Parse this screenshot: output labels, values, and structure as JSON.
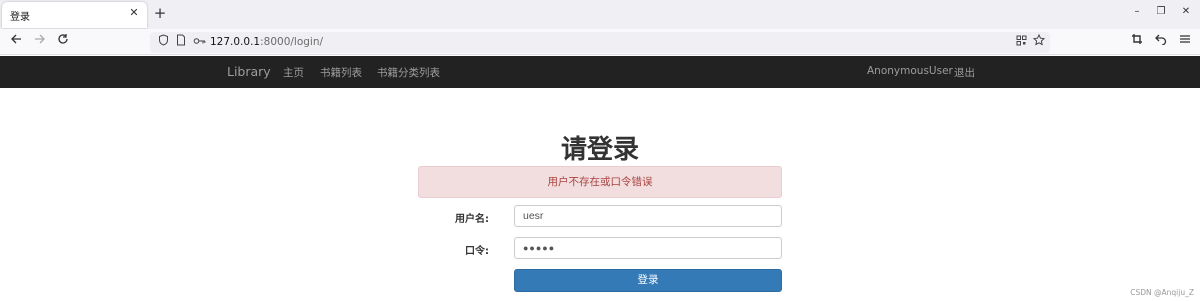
{
  "browser": {
    "tab_title": "登录",
    "tab_close": "✕",
    "new_tab": "+",
    "url_host": "127.0.0.1",
    "url_rest": ":8000/login/",
    "window_controls": {
      "minimize": "–",
      "restore": "❐",
      "close": "✕"
    },
    "icons": [
      "back-arrow",
      "forward-arrow",
      "reload",
      "shield",
      "page",
      "key",
      "qr-code",
      "star",
      "crop",
      "undo",
      "menu"
    ]
  },
  "navbar": {
    "brand": "Library",
    "links": [
      "主页",
      "书籍列表",
      "书籍分类列表"
    ],
    "user": "AnonymousUser",
    "logout": "退出"
  },
  "login": {
    "title": "请登录",
    "alert": "用户不存在或口令错误",
    "username_label": "用户名:",
    "username_value": "uesr",
    "password_label": "口令:",
    "password_value": "●●●●●",
    "submit": "登录"
  },
  "watermark": "CSDN @Anqiju_Z",
  "colors": {
    "navbar_bg": "#222222",
    "alert_bg": "#f2dede",
    "alert_text": "#a94442",
    "button_bg": "#337ab7"
  }
}
